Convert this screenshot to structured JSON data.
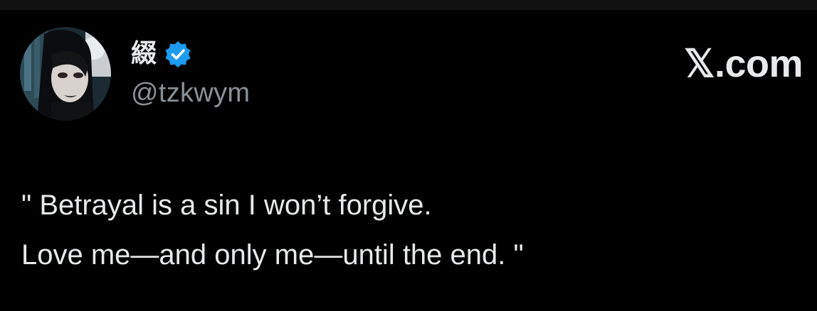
{
  "author": {
    "display_name": "綴",
    "handle": "@tzkwym",
    "verified": true,
    "verified_badge_color": "#1d9bf0",
    "avatar_icon": "profile-photo-avatar"
  },
  "brand": {
    "label": "𝕏.com",
    "icon": "x-logo"
  },
  "tweet": {
    "lines": [
      "\" Betrayal is a sin I won’t forgive.",
      "Love me—and only me—until the end. \""
    ]
  },
  "colors": {
    "background": "#000000",
    "text": "#e7e9ea",
    "secondary_text": "#8b9197"
  }
}
